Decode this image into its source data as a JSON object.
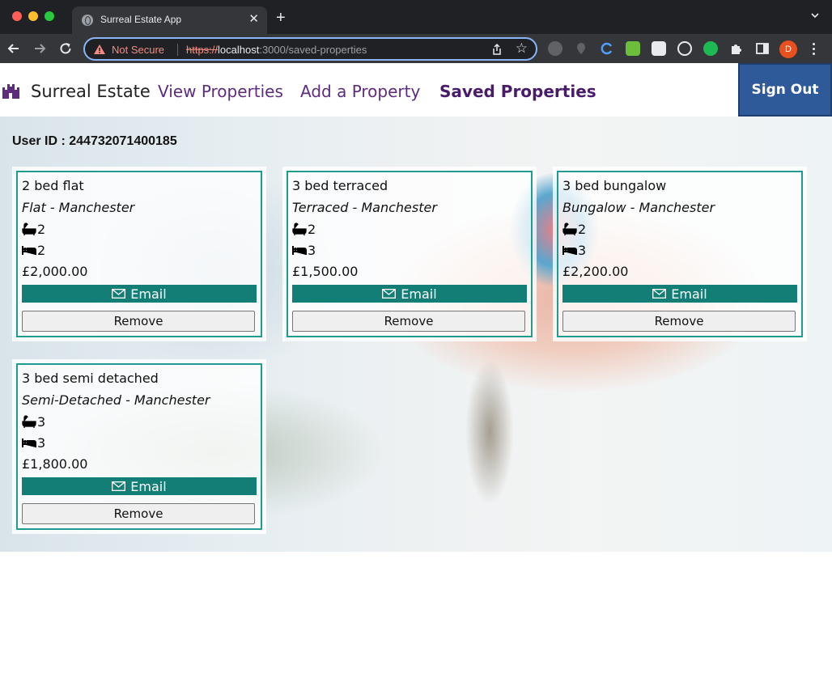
{
  "browser": {
    "tab_title": "Surreal Estate App",
    "tab_close": "✕",
    "new_tab": "+",
    "security_label": "Not Secure",
    "url_scheme": "https://",
    "url_host": "localhost",
    "url_rest": ":3000/saved-properties",
    "profile_initial": "D"
  },
  "app": {
    "brand": "Surreal Estate",
    "nav": [
      {
        "label": "View Properties"
      },
      {
        "label": "Add a Property"
      },
      {
        "label": "Saved Properties"
      }
    ],
    "sign_out": "Sign Out",
    "user_id_label": "User ID : 244732071400185",
    "email_label": "Email",
    "remove_label": "Remove"
  },
  "colors": {
    "accent_teal": "#127e76",
    "card_border": "#1f9c90",
    "nav_purple": "#5e2b7e",
    "signout_blue": "#2e5a99"
  },
  "properties": [
    {
      "title": "2 bed flat",
      "subtitle": "Flat - Manchester",
      "bathrooms": "2",
      "bedrooms": "2",
      "price": "£2,000.00"
    },
    {
      "title": "3 bed terraced",
      "subtitle": "Terraced - Manchester",
      "bathrooms": "2",
      "bedrooms": "3",
      "price": "£1,500.00"
    },
    {
      "title": "3 bed bungalow",
      "subtitle": "Bungalow - Manchester",
      "bathrooms": "2",
      "bedrooms": "3",
      "price": "£2,200.00"
    },
    {
      "title": "3 bed semi detached",
      "subtitle": "Semi-Detached - Manchester",
      "bathrooms": "3",
      "bedrooms": "3",
      "price": "£1,800.00"
    }
  ]
}
